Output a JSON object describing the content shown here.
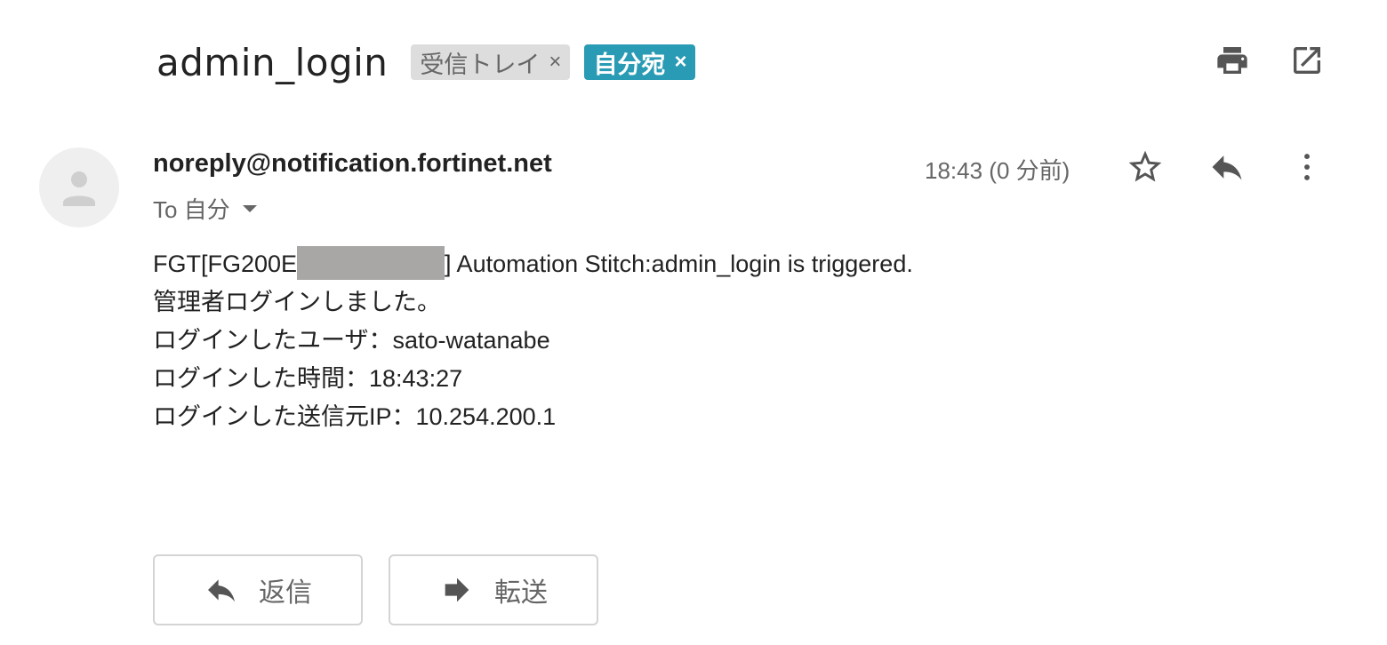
{
  "subject": "admin_login",
  "labels": [
    {
      "text": "受信トレイ",
      "remove": "×"
    },
    {
      "text": "自分宛",
      "remove": "×"
    }
  ],
  "toolbar": {
    "print_icon": "print-icon",
    "open_new_window_icon": "open-in-new-window-icon"
  },
  "message": {
    "sender": "noreply@notification.fortinet.net",
    "recipient": "To 自分",
    "time": "18:43 (0 分前)",
    "icons": {
      "star": "star-icon",
      "reply": "reply-icon",
      "more": "more-vertical-icon"
    },
    "body": {
      "line1_prefix": "FGT[FG200E",
      "line1_suffix": "] Automation Stitch:admin_login is triggered.",
      "lines": [
        "管理者ログインしました。",
        "ログインしたユーザ：sato-watanabe",
        "ログインした時間：18:43:27",
        "ログインした送信元IP：10.254.200.1"
      ]
    }
  },
  "actions": {
    "reply_label": "返信",
    "forward_label": "転送"
  },
  "colors": {
    "label_me_bg": "#2a9bb4",
    "label_inbox_bg": "#dddddd",
    "redaction": "#a9a6a6"
  }
}
